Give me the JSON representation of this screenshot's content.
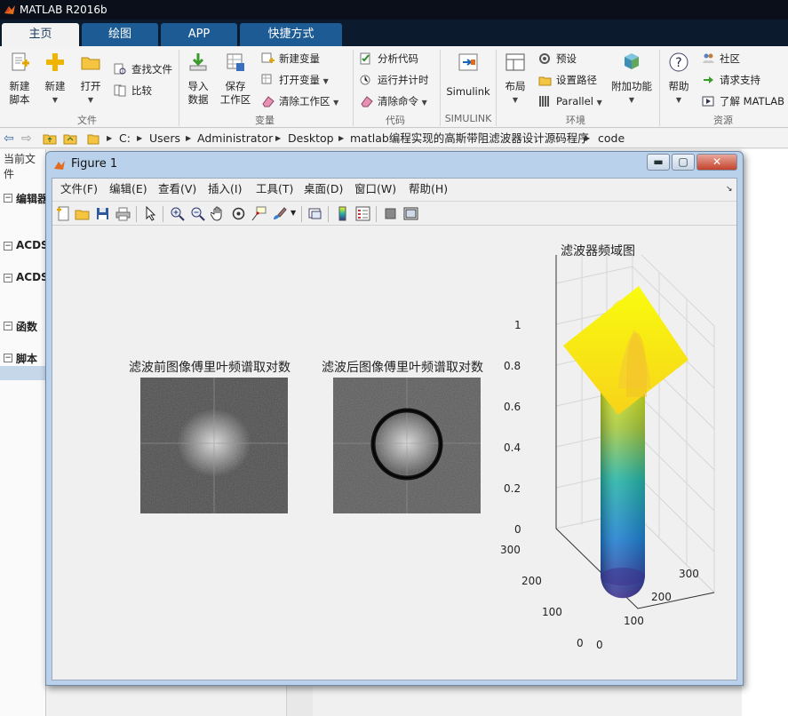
{
  "app": {
    "title": "MATLAB R2016b"
  },
  "tabs": [
    "主页",
    "绘图",
    "APP",
    "快捷方式"
  ],
  "ribbon": {
    "file_group": {
      "label": "文件",
      "new_script": [
        "新建",
        "脚本"
      ],
      "new": "新建",
      "open": "打开",
      "find_files": "查找文件",
      "compare": "比较"
    },
    "variable_group": {
      "label": "变量",
      "import": [
        "导入",
        "数据"
      ],
      "save_ws": [
        "保存",
        "工作区"
      ],
      "new_var": "新建变量",
      "open_var": "打开变量",
      "clear_ws": "清除工作区"
    },
    "code_group": {
      "label": "代码",
      "analyze": "分析代码",
      "run_time": "运行并计时",
      "clear_cmd": "清除命令"
    },
    "simulink_group": {
      "label": "SIMULINK",
      "simulink": "Simulink"
    },
    "env_group": {
      "label": "环境",
      "layout": "布局",
      "prefs": "预设",
      "set_path": "设置路径",
      "parallel": "Parallel",
      "addons": "附加功能"
    },
    "res_group": {
      "label": "资源",
      "help": "帮助",
      "community": "社区",
      "support": "请求支持",
      "learn": "了解 MATLAB"
    }
  },
  "address": {
    "crumbs": [
      "C:",
      "Users",
      "Administrator",
      "Desktop",
      "matlab编程实现的高斯带阻滤波器设计源码程序",
      "code"
    ]
  },
  "left_pane": {
    "header": "当前文件",
    "items": [
      "编辑器",
      "ACDS",
      "ACDS",
      "函数",
      "脚本"
    ]
  },
  "figure": {
    "title": "Figure 1",
    "menus": [
      "文件(F)",
      "编辑(E)",
      "查看(V)",
      "插入(I)",
      "工具(T)",
      "桌面(D)",
      "窗口(W)",
      "帮助(H)"
    ],
    "axes": [
      {
        "title": "滤波前图像傅里叶频谱取对数"
      },
      {
        "title": "滤波后图像傅里叶频谱取对数"
      },
      {
        "title": "滤波器频域图",
        "z_ticks": [
          "0",
          "0.2",
          "0.4",
          "0.6",
          "0.8",
          "1"
        ],
        "x_ticks": [
          "0",
          "100",
          "200",
          "300"
        ],
        "y_ticks": [
          "0",
          "100",
          "200",
          "300"
        ]
      }
    ]
  },
  "colors": {
    "title_bar": "#0b0f1a",
    "tab_blue": "#1d5b95",
    "figure_frame": "#b9d1ea",
    "surface_low": "#3d2f8e",
    "surface_high": "#f9fb0e"
  }
}
